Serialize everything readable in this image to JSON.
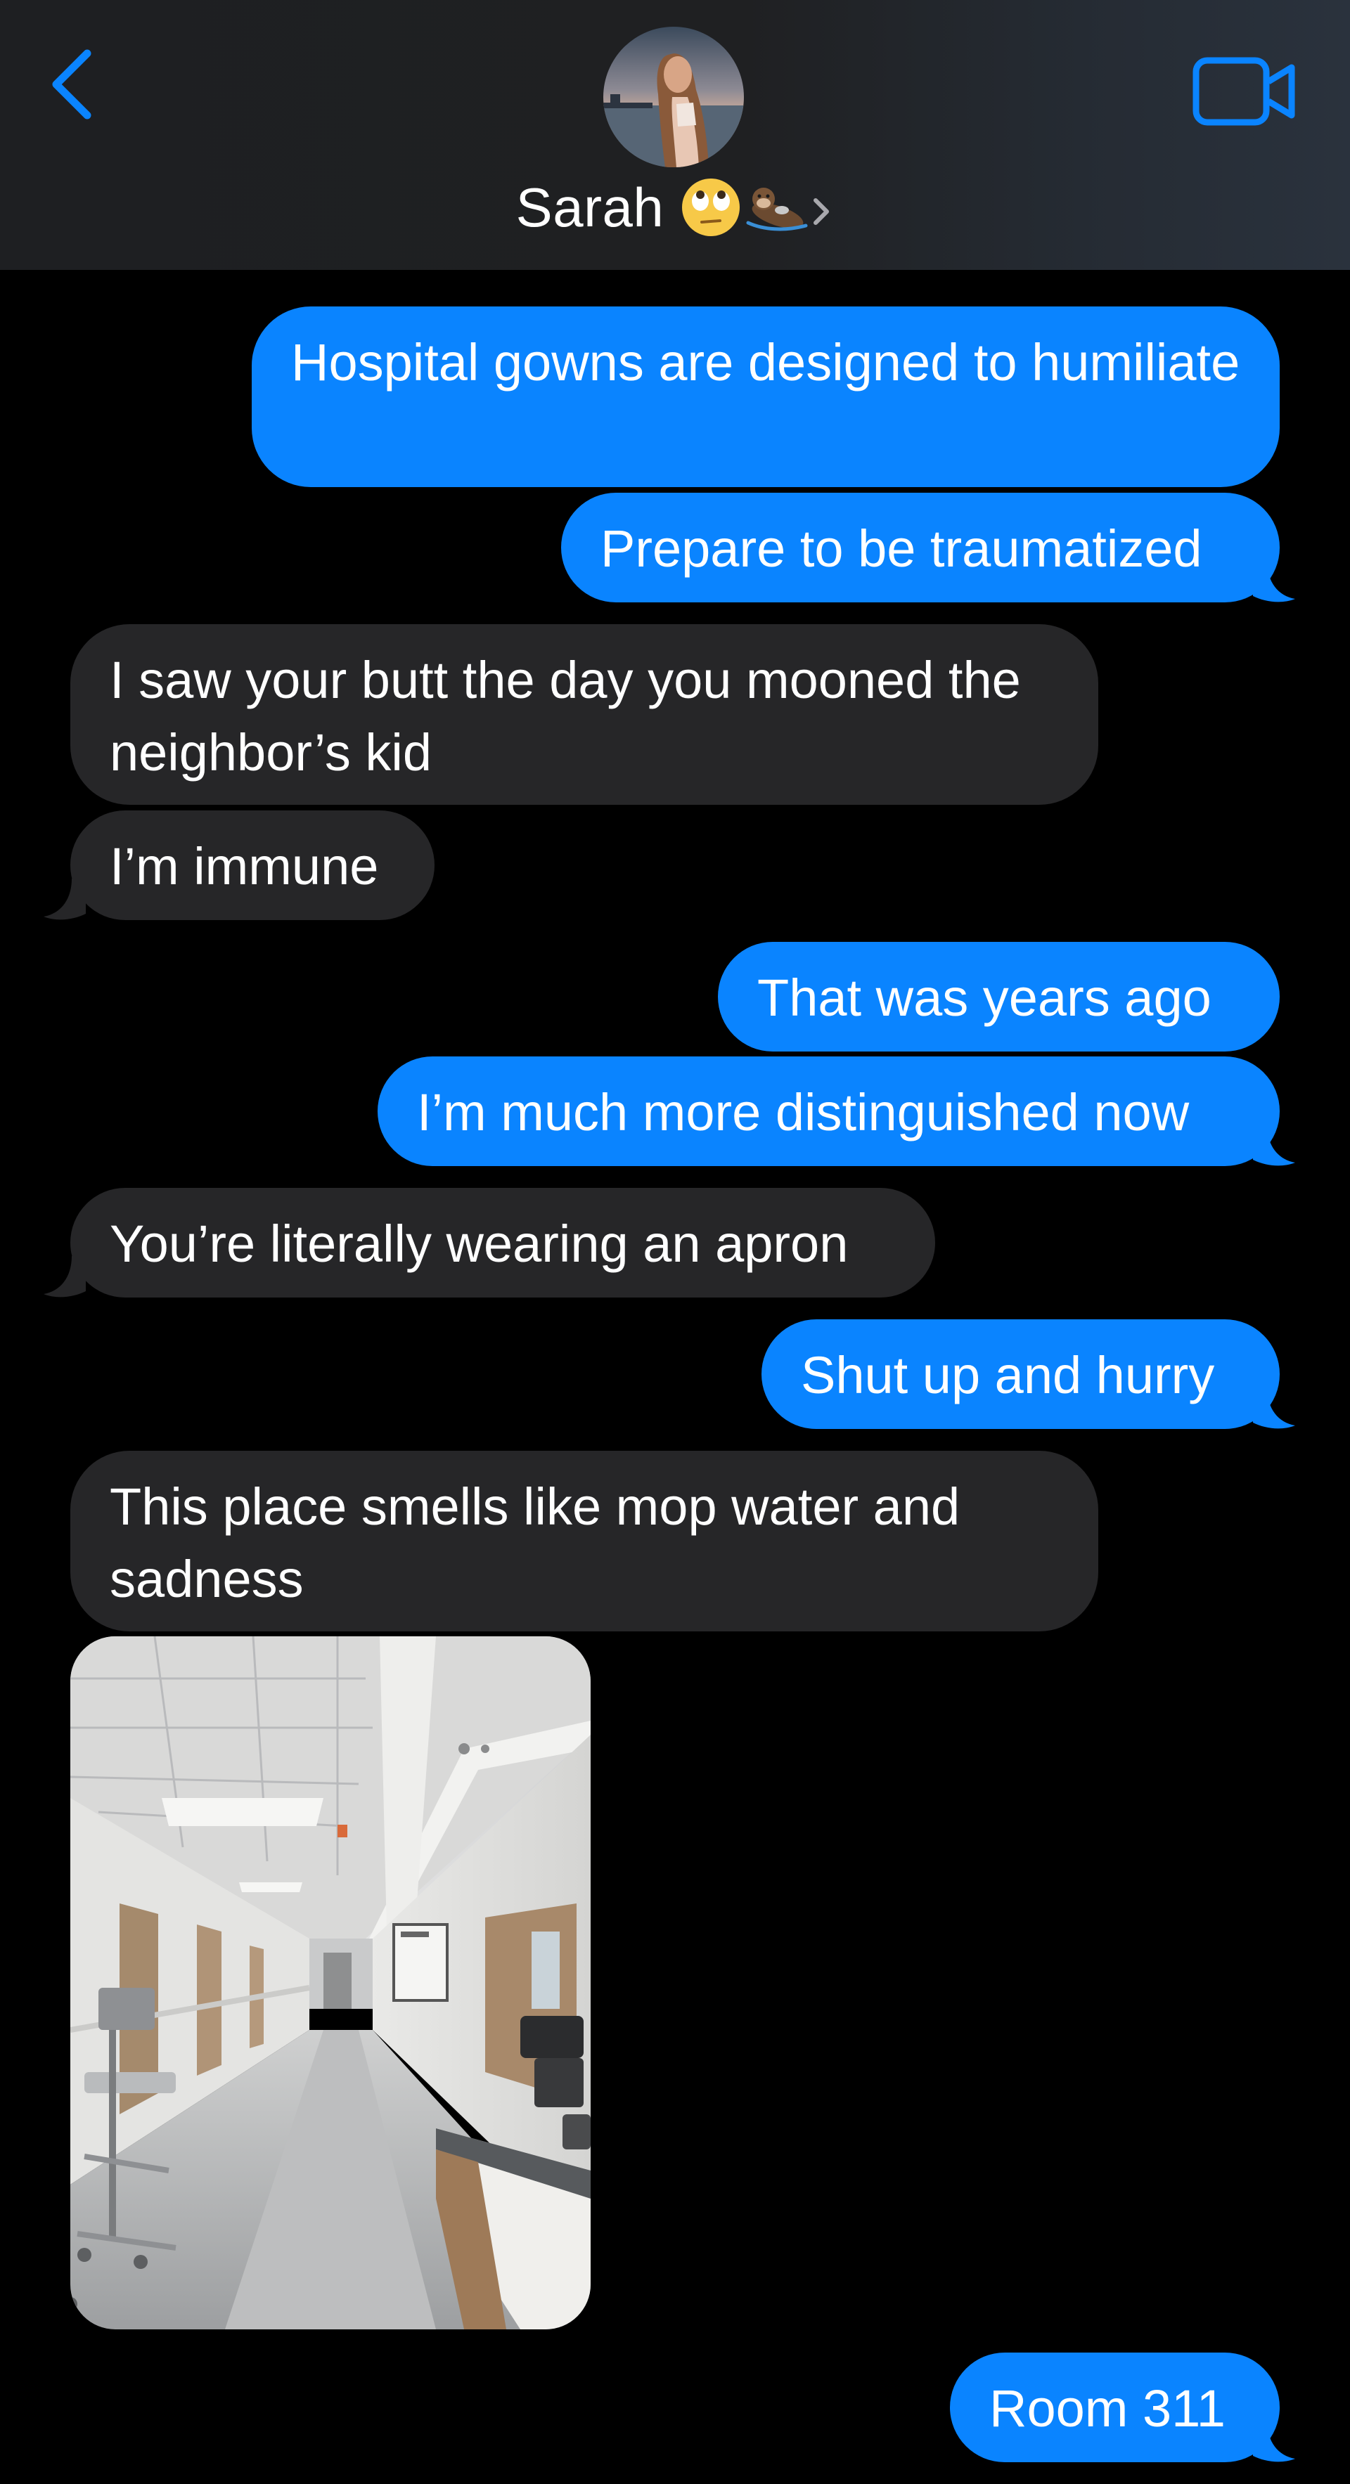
{
  "header": {
    "contact_name": "Sarah",
    "back_icon": "chevron-left-icon",
    "video_icon": "video-camera-icon",
    "name_emoji": [
      "face-with-rolling-eyes-emoji",
      "otter-emoji"
    ],
    "accent_color": "#0a84ff"
  },
  "messages": [
    {
      "side": "sent",
      "text": "Hospital gowns are designed to humiliate"
    },
    {
      "side": "sent",
      "text": "Prepare to be traumatized"
    },
    {
      "side": "received",
      "text": "I saw your butt the day you mooned the neighbor’s kid"
    },
    {
      "side": "received",
      "text": "I’m immune"
    },
    {
      "side": "sent",
      "text": "That was years ago"
    },
    {
      "side": "sent",
      "text": "I’m much more distinguished now"
    },
    {
      "side": "received",
      "text": "You’re literally wearing an apron"
    },
    {
      "side": "sent",
      "text": "Shut up and hurry"
    },
    {
      "side": "received",
      "text": "This place smells like mop water and sadness"
    },
    {
      "side": "received",
      "type": "photo",
      "subject": "hospital corridor"
    },
    {
      "side": "sent",
      "text": "Room 311"
    }
  ],
  "colors": {
    "sent_bubble": "#0a84ff",
    "received_bubble": "#262628",
    "background": "#000000"
  }
}
